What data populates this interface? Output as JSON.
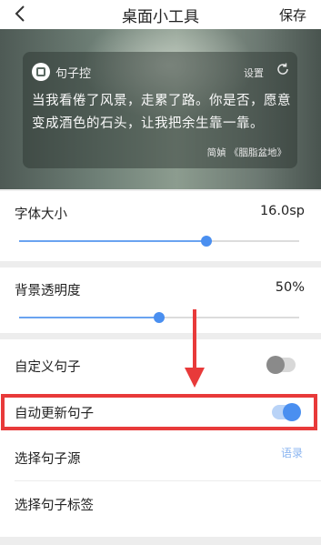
{
  "header": {
    "title": "桌面小工具",
    "save_label": "保存"
  },
  "widget": {
    "app_name": "句子控",
    "settings_label": "设置",
    "quote": "当我看倦了风景，走累了路。你是否，愿意变成酒色的石头，让我把余生靠一靠。",
    "source": "简媜 《胭脂盆地》"
  },
  "font_size": {
    "label": "字体大小",
    "value": "16.0sp",
    "slider_level": 0.67
  },
  "opacity": {
    "label": "背景透明度",
    "value": "50%",
    "slider_level": 0.5
  },
  "custom_sentence": {
    "label": "自定义句子",
    "enabled": false
  },
  "auto_update": {
    "label": "自动更新句子",
    "enabled": true
  },
  "sentence_source": {
    "label": "选择句子源",
    "value": "语录"
  },
  "sentence_tags": {
    "label": "选择句子标签"
  },
  "colors": {
    "accent": "#4a8ff0",
    "annotation": "#e83a3a"
  },
  "icons": {
    "back": "chevron-left-icon",
    "refresh": "refresh-icon",
    "logo": "app-logo-icon"
  }
}
